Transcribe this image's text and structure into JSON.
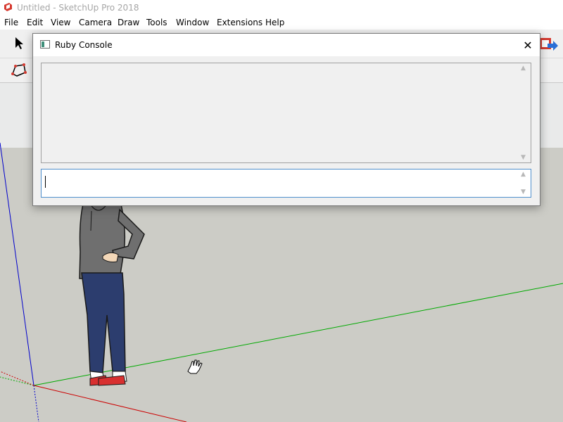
{
  "window": {
    "title": "Untitled - SketchUp Pro 2018"
  },
  "menu": [
    "File",
    "Edit",
    "View",
    "Camera",
    "Draw",
    "Tools",
    "Window",
    "Extensions",
    "Help"
  ],
  "toolbar": {
    "tools": [
      "select-tool-icon",
      "polygon-tool-icon",
      "extension-warehouse-icon"
    ]
  },
  "dialog": {
    "title": "Ruby Console",
    "close_symbol": "✕",
    "output_text": "",
    "input_value": ""
  },
  "colors": {
    "app_icon": "#d63a30",
    "viewport_ground": "#ccccc6",
    "viewport_sky": "#e9eaea",
    "axis_red": "#cc0000",
    "axis_green": "#00aa00",
    "axis_blue": "#0000cc",
    "input_border": "#4f8fcc"
  }
}
